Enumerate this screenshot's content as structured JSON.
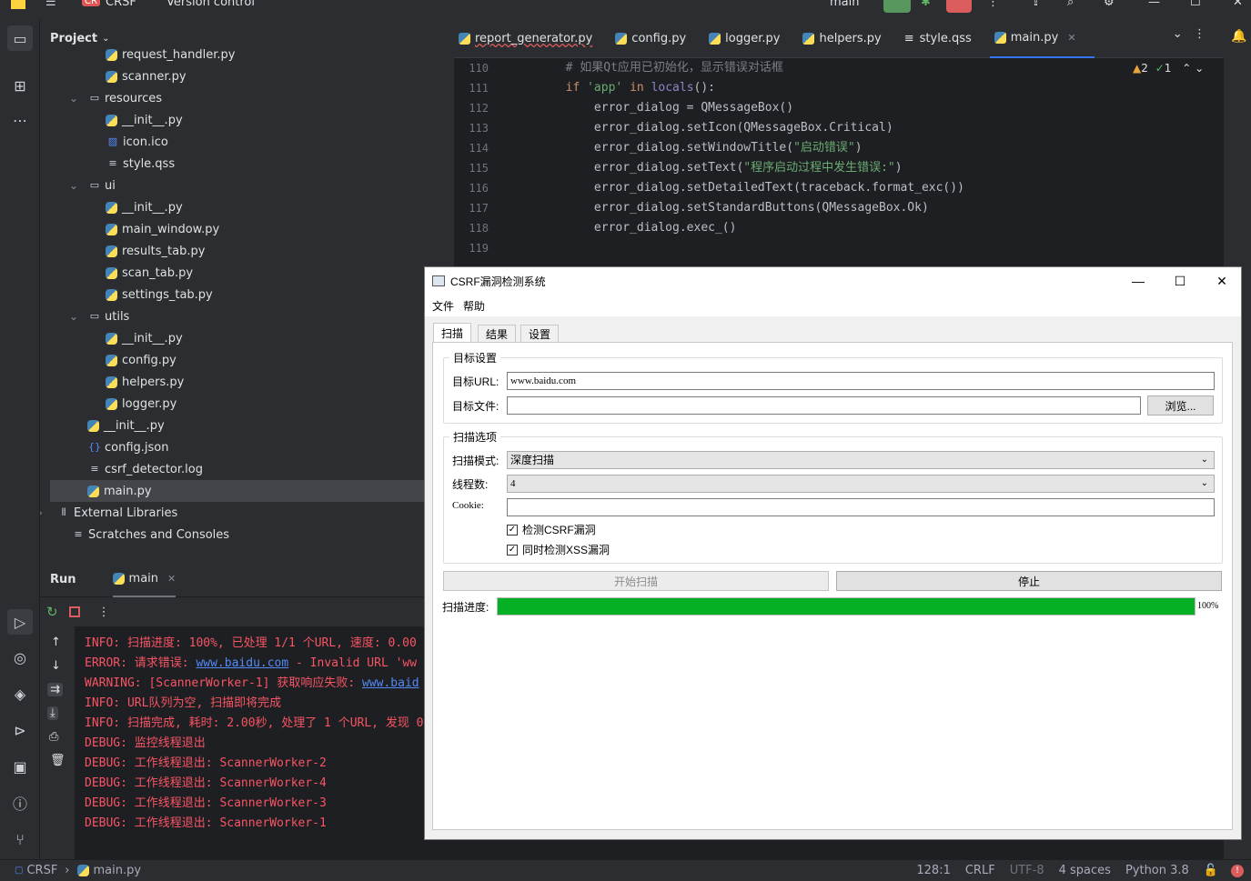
{
  "titlebar": {
    "project_badge": "CR",
    "project_name": "CRSF",
    "vcs": "Version control",
    "branch": "main"
  },
  "project_panel": {
    "title": "Project",
    "tree": [
      {
        "label": "request_handler.py",
        "type": "py"
      },
      {
        "label": "scanner.py",
        "type": "py"
      },
      {
        "label": "resources",
        "type": "folder"
      },
      {
        "label": "__init__.py",
        "type": "py"
      },
      {
        "label": "icon.ico",
        "type": "ico"
      },
      {
        "label": "style.qss",
        "type": "txt"
      },
      {
        "label": "ui",
        "type": "folder"
      },
      {
        "label": "__init__.py",
        "type": "py"
      },
      {
        "label": "main_window.py",
        "type": "py"
      },
      {
        "label": "results_tab.py",
        "type": "py"
      },
      {
        "label": "scan_tab.py",
        "type": "py"
      },
      {
        "label": "settings_tab.py",
        "type": "py"
      },
      {
        "label": "utils",
        "type": "folder"
      },
      {
        "label": "__init__.py",
        "type": "py"
      },
      {
        "label": "config.py",
        "type": "py"
      },
      {
        "label": "helpers.py",
        "type": "py"
      },
      {
        "label": "logger.py",
        "type": "py"
      },
      {
        "label": "__init__.py",
        "type": "py"
      },
      {
        "label": "config.json",
        "type": "json"
      },
      {
        "label": "csrf_detector.log",
        "type": "txt"
      },
      {
        "label": "main.py",
        "type": "py"
      },
      {
        "label": "External Libraries",
        "type": "lib"
      },
      {
        "label": "Scratches and Consoles",
        "type": "scratch"
      }
    ]
  },
  "editor": {
    "tabs": [
      "report_generator.py",
      "config.py",
      "logger.py",
      "helpers.py",
      "style.qss",
      "main.py"
    ],
    "active_tab": "main.py",
    "inspections": {
      "warnings": "2",
      "ok": "1"
    },
    "lines": [
      {
        "n": "110",
        "text": "        # 如果Qt应用已初始化，显示错误对话框"
      },
      {
        "n": "111",
        "text": "        if 'app' in locals():"
      },
      {
        "n": "112",
        "text": "            error_dialog = QMessageBox()"
      },
      {
        "n": "113",
        "text": "            error_dialog.setIcon(QMessageBox.Critical)"
      },
      {
        "n": "114",
        "text": "            error_dialog.setWindowTitle(\"启动错误\")"
      },
      {
        "n": "115",
        "text": "            error_dialog.setText(\"程序启动过程中发生错误:\")"
      },
      {
        "n": "116",
        "text": "            error_dialog.setDetailedText(traceback.format_exc())"
      },
      {
        "n": "117",
        "text": "            error_dialog.setStandardButtons(QMessageBox.Ok)"
      },
      {
        "n": "118",
        "text": "            error_dialog.exec_()"
      },
      {
        "n": "119",
        "text": ""
      }
    ]
  },
  "run_panel": {
    "title": "Run",
    "tab": "main",
    "console": [
      {
        "text": "INFO: 扫描进度: 100%, 已处理 1/1 个URL, 速度: 0.00",
        "link": ""
      },
      {
        "text": "ERROR: 请求错误: ",
        "link": "www.baidu.com",
        "tail": " - Invalid URL 'ww"
      },
      {
        "text": "WARNING: [ScannerWorker-1] 获取响应失败: ",
        "link": "www.baid",
        "tail": ""
      },
      {
        "text": "INFO: URL队列为空, 扫描即将完成",
        "link": ""
      },
      {
        "text": "INFO: 扫描完成, 耗时: 2.00秒, 处理了 1 个URL, 发现 0",
        "link": ""
      },
      {
        "text": "DEBUG: 监控线程退出",
        "link": ""
      },
      {
        "text": "DEBUG: 工作线程退出: ScannerWorker-2",
        "link": ""
      },
      {
        "text": "DEBUG: 工作线程退出: ScannerWorker-4",
        "link": ""
      },
      {
        "text": "DEBUG: 工作线程退出: ScannerWorker-3",
        "link": ""
      },
      {
        "text": "DEBUG: 工作线程退出: ScannerWorker-1",
        "link": ""
      }
    ]
  },
  "statusbar": {
    "crumb1": "CRSF",
    "crumb2": "main.py",
    "position": "128:1",
    "line_sep": "CRLF",
    "encoding": "UTF-8",
    "indent": "4 spaces",
    "interpreter": "Python 3.8"
  },
  "app": {
    "title": "CSRF漏洞检测系统",
    "menu": [
      "文件",
      "帮助"
    ],
    "tabs": [
      "扫描",
      "结果",
      "设置"
    ],
    "target_group": "目标设置",
    "url_label": "目标URL:",
    "url_value": "www.baidu.com",
    "file_label": "目标文件:",
    "file_value": "",
    "browse": "浏览...",
    "options_group": "扫描选项",
    "mode_label": "扫描模式:",
    "mode_value": "深度扫描",
    "threads_label": "线程数:",
    "threads_value": "4",
    "cookie_label": "Cookie:",
    "cookie_value": "",
    "check_csrf": "检测CSRF漏洞",
    "check_xss": "同时检测XSS漏洞",
    "start": "开始扫描",
    "stop": "停止",
    "progress_label": "扫描进度:",
    "progress": 100,
    "progress_text": "100%"
  }
}
